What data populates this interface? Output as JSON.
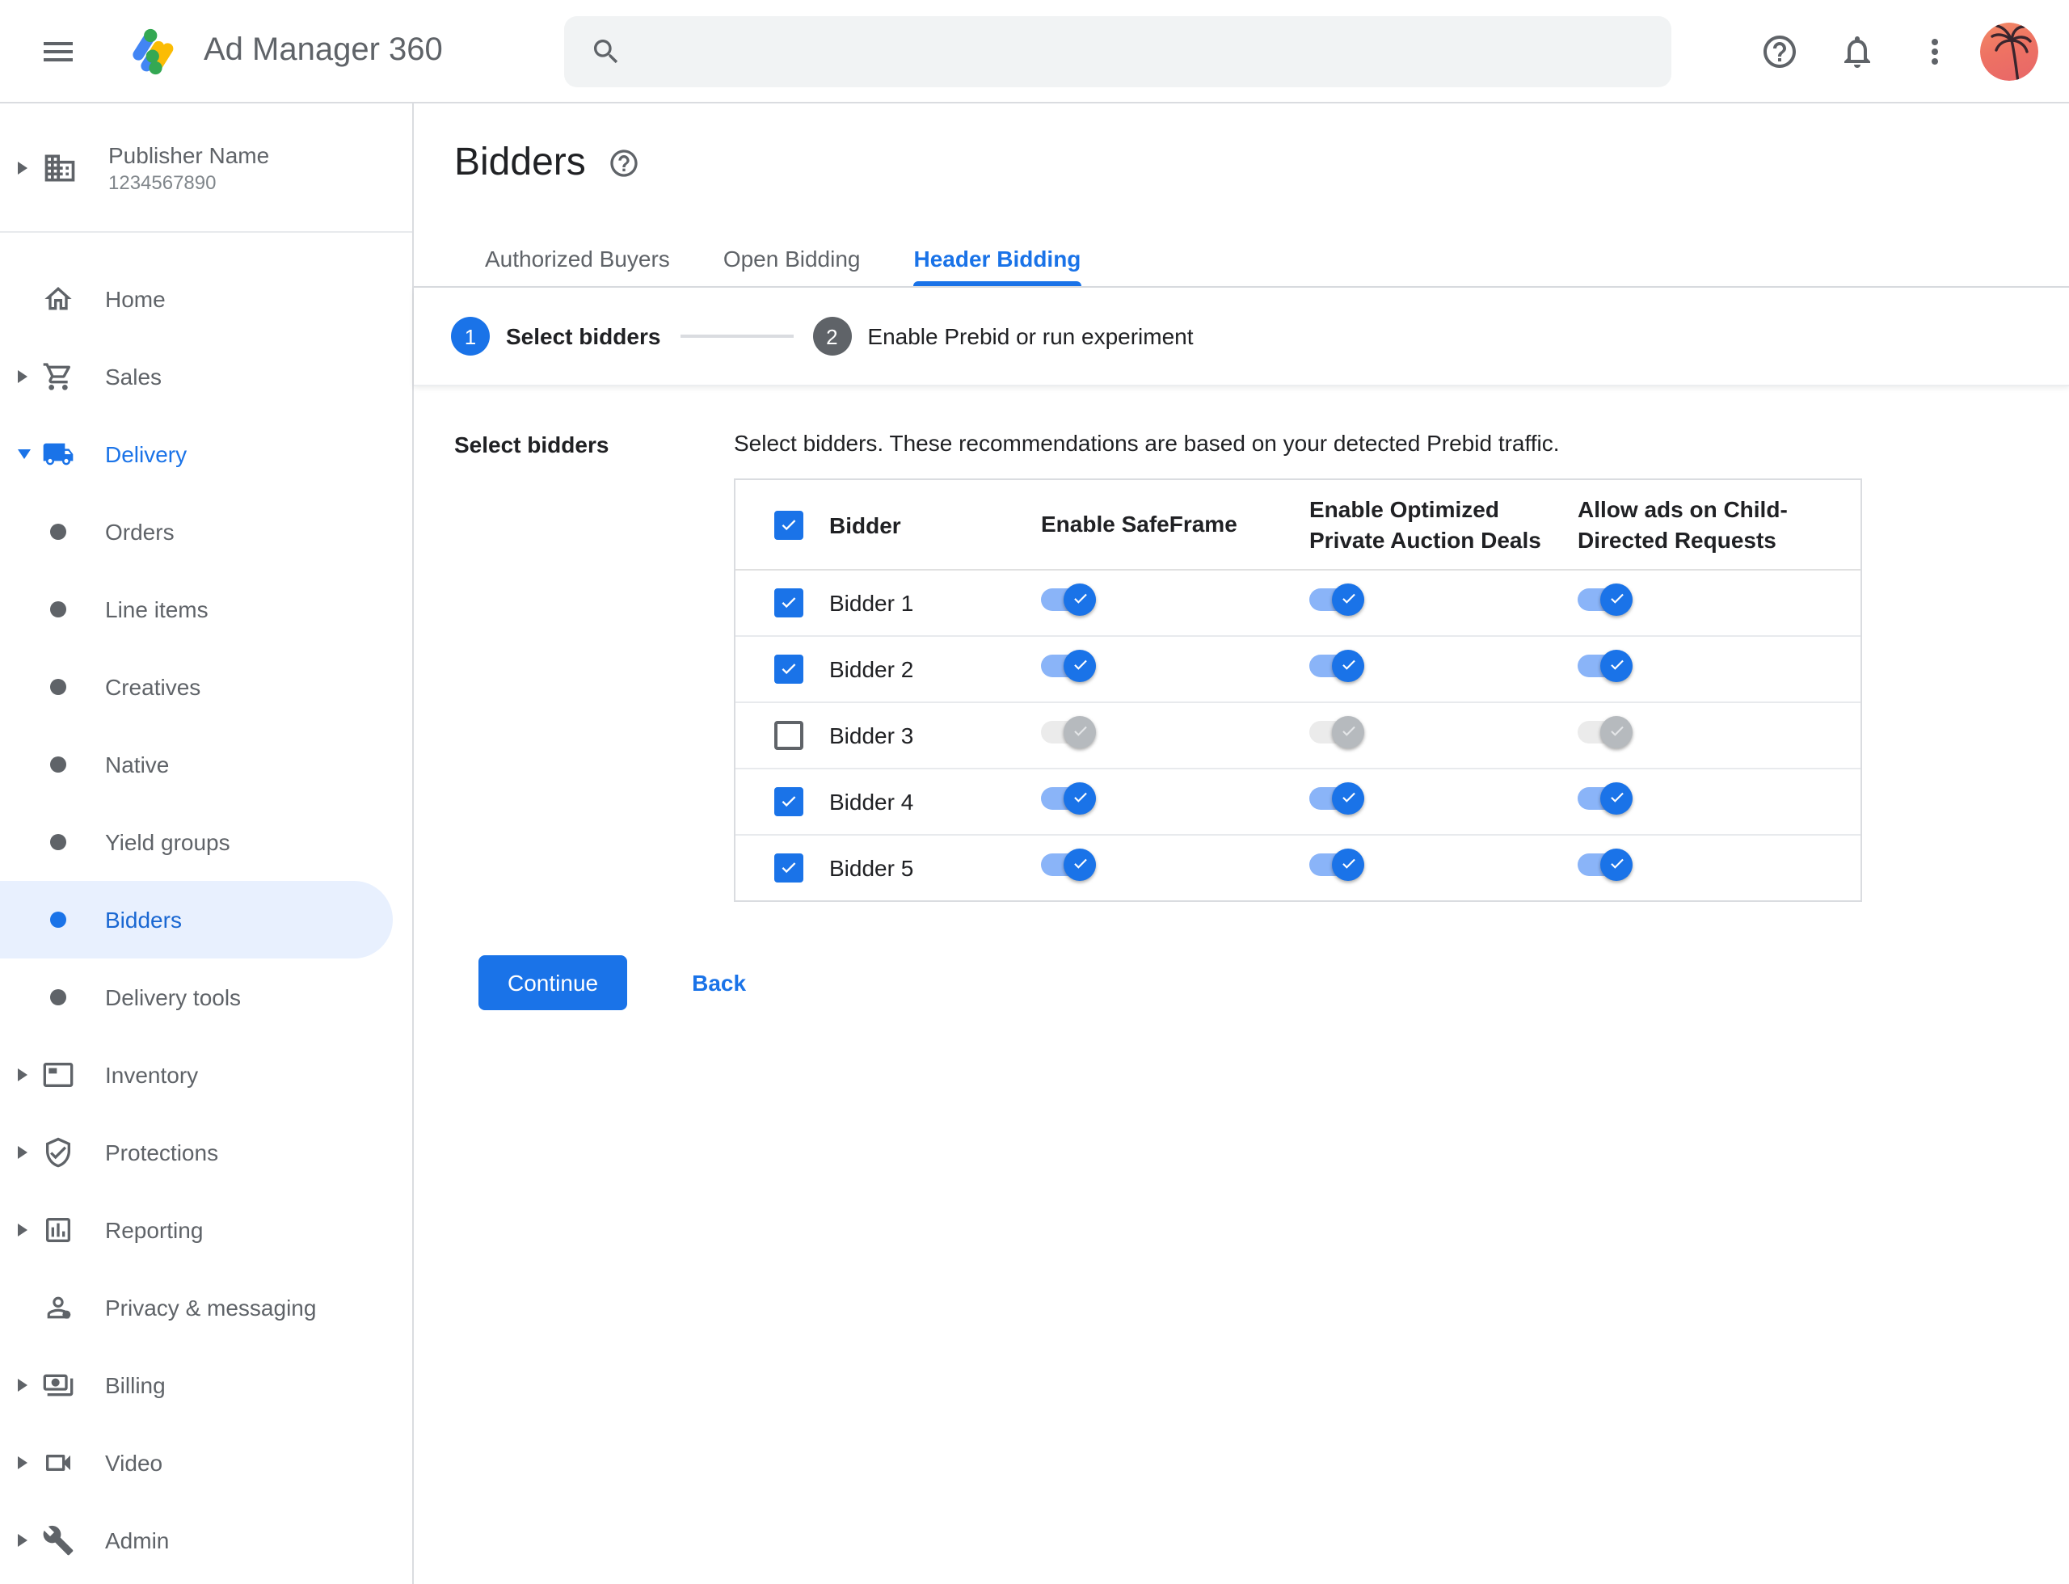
{
  "topbar": {
    "app_title": "Ad Manager 360",
    "search_placeholder": ""
  },
  "sidebar": {
    "publisher": {
      "name": "Publisher Name",
      "id": "1234567890"
    },
    "items": [
      {
        "label": "Home",
        "icon": "home-icon",
        "expandable": false
      },
      {
        "label": "Sales",
        "icon": "cart-icon",
        "expandable": true
      },
      {
        "label": "Delivery",
        "icon": "truck-icon",
        "expandable": true,
        "expanded": true,
        "active_section": true
      },
      {
        "label": "Orders",
        "icon": "bullet"
      },
      {
        "label": "Line items",
        "icon": "bullet"
      },
      {
        "label": "Creatives",
        "icon": "bullet"
      },
      {
        "label": "Native",
        "icon": "bullet"
      },
      {
        "label": "Yield groups",
        "icon": "bullet"
      },
      {
        "label": "Bidders",
        "icon": "bullet",
        "selected": true
      },
      {
        "label": "Delivery tools",
        "icon": "bullet"
      },
      {
        "label": "Inventory",
        "icon": "ad-unit-icon",
        "expandable": true
      },
      {
        "label": "Protections",
        "icon": "shield-check-icon",
        "expandable": true
      },
      {
        "label": "Reporting",
        "icon": "bar-chart-icon",
        "expandable": true
      },
      {
        "label": "Privacy & messaging",
        "icon": "person-badge-icon",
        "expandable": false
      },
      {
        "label": "Billing",
        "icon": "money-icon",
        "expandable": true
      },
      {
        "label": "Video",
        "icon": "video-camera-icon",
        "expandable": true
      },
      {
        "label": "Admin",
        "icon": "wrench-icon",
        "expandable": true
      }
    ]
  },
  "page": {
    "title": "Bidders",
    "tabs": [
      {
        "label": "Authorized Buyers",
        "active": false
      },
      {
        "label": "Open Bidding",
        "active": false
      },
      {
        "label": "Header Bidding",
        "active": true
      }
    ],
    "stepper": [
      {
        "number": "1",
        "label": "Select bidders",
        "active": true
      },
      {
        "number": "2",
        "label": "Enable Prebid or run experiment",
        "active": false
      }
    ],
    "section_label": "Select bidders",
    "description": "Select bidders. These recommendations are based on your detected Prebid traffic.",
    "table": {
      "header_checkbox_checked": true,
      "columns": [
        "Bidder",
        "Enable SafeFrame",
        "Enable Optimized Private Auction Deals",
        "Allow ads on Child-Directed Requests"
      ],
      "rows": [
        {
          "name": "Bidder 1",
          "selected": true,
          "enable_safeframe": true,
          "enable_optimized_private_auction_deals": true,
          "allow_ads_child_directed": true
        },
        {
          "name": "Bidder 2",
          "selected": true,
          "enable_safeframe": true,
          "enable_optimized_private_auction_deals": true,
          "allow_ads_child_directed": true
        },
        {
          "name": "Bidder 3",
          "selected": false,
          "enable_safeframe": false,
          "enable_optimized_private_auction_deals": false,
          "allow_ads_child_directed": false
        },
        {
          "name": "Bidder 4",
          "selected": true,
          "enable_safeframe": true,
          "enable_optimized_private_auction_deals": true,
          "allow_ads_child_directed": true
        },
        {
          "name": "Bidder 5",
          "selected": true,
          "enable_safeframe": true,
          "enable_optimized_private_auction_deals": true,
          "allow_ads_child_directed": true
        }
      ]
    },
    "actions": {
      "continue_label": "Continue",
      "back_label": "Back"
    }
  },
  "colors": {
    "accent": "#1a73e8",
    "selected_item_text": "#1967d2",
    "selected_item_bg": "#e8f0fe",
    "toggle_track_on": "#8ab4f8",
    "toggle_disabled_thumb": "#b6babe",
    "text_primary": "#202124",
    "text_muted": "#5f6368",
    "border": "#dadce0"
  }
}
